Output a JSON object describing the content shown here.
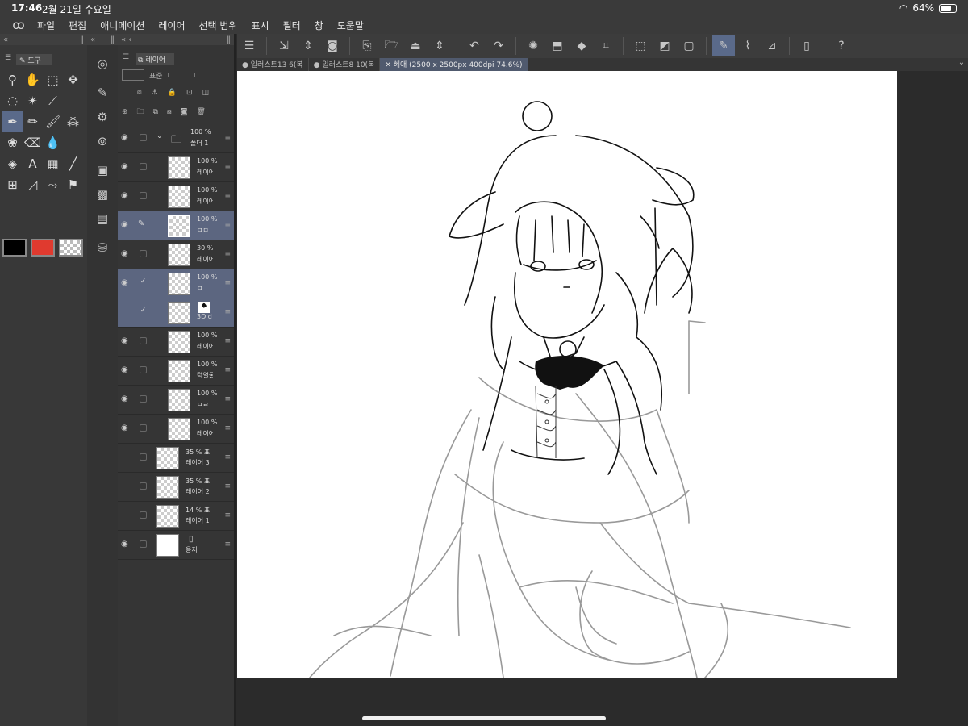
{
  "status": {
    "time": "17:46",
    "date": "2월 21일 수요일",
    "battery": "64%",
    "battery_level": 0.64
  },
  "menu": {
    "logo": "clip-studio-logo-icon",
    "items": [
      "파일",
      "편집",
      "애니메이션",
      "레이어",
      "선택 범위",
      "표시",
      "필터",
      "창",
      "도움말"
    ]
  },
  "canvas_tabs": [
    {
      "label": "일러스트13 6(복",
      "active": false
    },
    {
      "label": "일러스트8 10(복",
      "active": false
    },
    {
      "label": "혜애 (2500 x 2500px 400dpi 74.6%)",
      "active": true
    }
  ],
  "tool_panel": {
    "tab_label": "도구",
    "fg_color": "#000000",
    "bg_color": "#e03a2f"
  },
  "layer_panel": {
    "tab_label": "레이어",
    "blend_mode": "표준",
    "layers": [
      {
        "percent": "100 %",
        "name": "폴더 1",
        "visible": true,
        "folder": true,
        "selected": false,
        "checked": false
      },
      {
        "percent": "100 %",
        "name": "레이어",
        "visible": true,
        "folder": false,
        "selected": false,
        "checked": false,
        "indent": true
      },
      {
        "percent": "100 %",
        "name": "레이어",
        "visible": true,
        "folder": false,
        "selected": false,
        "checked": false,
        "indent": true
      },
      {
        "percent": "100 %",
        "name": "ㅁㅁ",
        "visible": true,
        "folder": false,
        "selected": true,
        "checked": false,
        "indent": true,
        "pen": true
      },
      {
        "percent": "30 %",
        "name": "레이어",
        "visible": true,
        "folder": false,
        "selected": false,
        "checked": false,
        "indent": true
      },
      {
        "percent": "100 %",
        "name": "ㅁ",
        "visible": true,
        "folder": false,
        "selected": true,
        "checked": true,
        "indent": true
      },
      {
        "percent": "",
        "name": "3D d",
        "visible": false,
        "folder": false,
        "selected": true,
        "checked": true,
        "indent": true
      },
      {
        "percent": "100 %",
        "name": "레이어",
        "visible": true,
        "folder": false,
        "selected": false,
        "checked": false,
        "indent": true
      },
      {
        "percent": "100 %",
        "name": "턱얼굴",
        "visible": true,
        "folder": false,
        "selected": false,
        "checked": false,
        "indent": true
      },
      {
        "percent": "100 %",
        "name": "ㅁㄹ",
        "visible": true,
        "folder": false,
        "selected": false,
        "checked": false,
        "indent": true
      },
      {
        "percent": "100 %",
        "name": "레이어",
        "visible": true,
        "folder": false,
        "selected": false,
        "checked": false,
        "indent": true
      },
      {
        "percent": "35 % 표",
        "name": "레이어 3",
        "visible": false,
        "folder": false,
        "selected": false,
        "checked": false
      },
      {
        "percent": "35 % 표",
        "name": "레이어 2",
        "visible": false,
        "folder": false,
        "selected": false,
        "checked": false
      },
      {
        "percent": "14 % 표",
        "name": "레이어 1",
        "visible": false,
        "folder": false,
        "selected": false,
        "checked": false
      },
      {
        "percent": "",
        "name": "용지",
        "visible": true,
        "folder": false,
        "selected": false,
        "checked": false,
        "paper": true
      }
    ]
  }
}
